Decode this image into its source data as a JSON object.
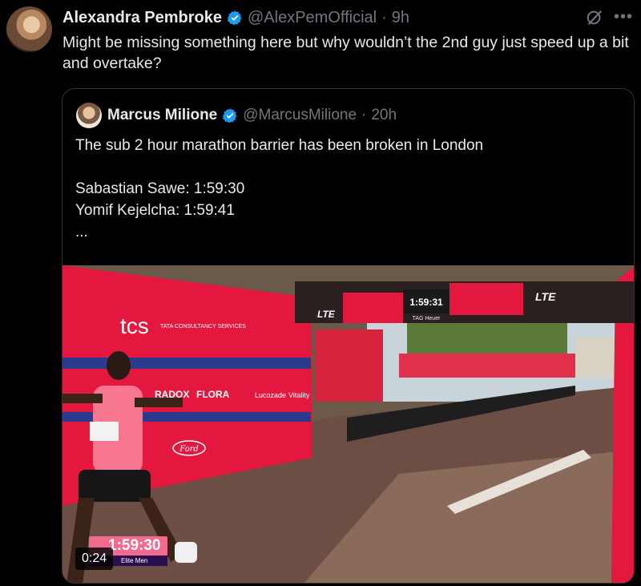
{
  "tweet": {
    "author_name": "Alexandra Pembroke",
    "handle": "@AlexPemOfficial",
    "separator": "·",
    "time": "9h",
    "text": "Might be missing something here but why wouldn’t the 2nd guy just speed up a bit and overtake?"
  },
  "quoted": {
    "author_name": "Marcus Milione",
    "handle": "@MarcusMilione",
    "separator": "·",
    "time": "20h",
    "lines": [
      "The sub 2 hour marathon barrier has been broken in London",
      "",
      "Sabastian Sawe:  1:59:30",
      "Yomif Kejelcha: 1:59:41",
      "..."
    ]
  },
  "video": {
    "clock": "1:59:31",
    "gantry_brand": "TAG Heuer",
    "gantry_left": "LTE",
    "gantry_right": "LTE",
    "banner_tcs": "tcs",
    "banner_tata": "TATA CONSULTANCY SERVICES",
    "sponsors": [
      "RADOX",
      "FLORA",
      "Lucozade",
      "Vitality",
      "Ford"
    ],
    "overlay_time": "1:59:30",
    "overlay_sub": "Elite Men",
    "timestamp": "0:24"
  },
  "colors": {
    "verified": "#1d9bf0",
    "banner_red": "#e4173f",
    "overlay_pink": "#f26a8d",
    "secondary_text": "#71767b"
  },
  "icons": {
    "verified": "verified-badge-icon",
    "grok": "grok-icon",
    "more": "more-icon"
  }
}
